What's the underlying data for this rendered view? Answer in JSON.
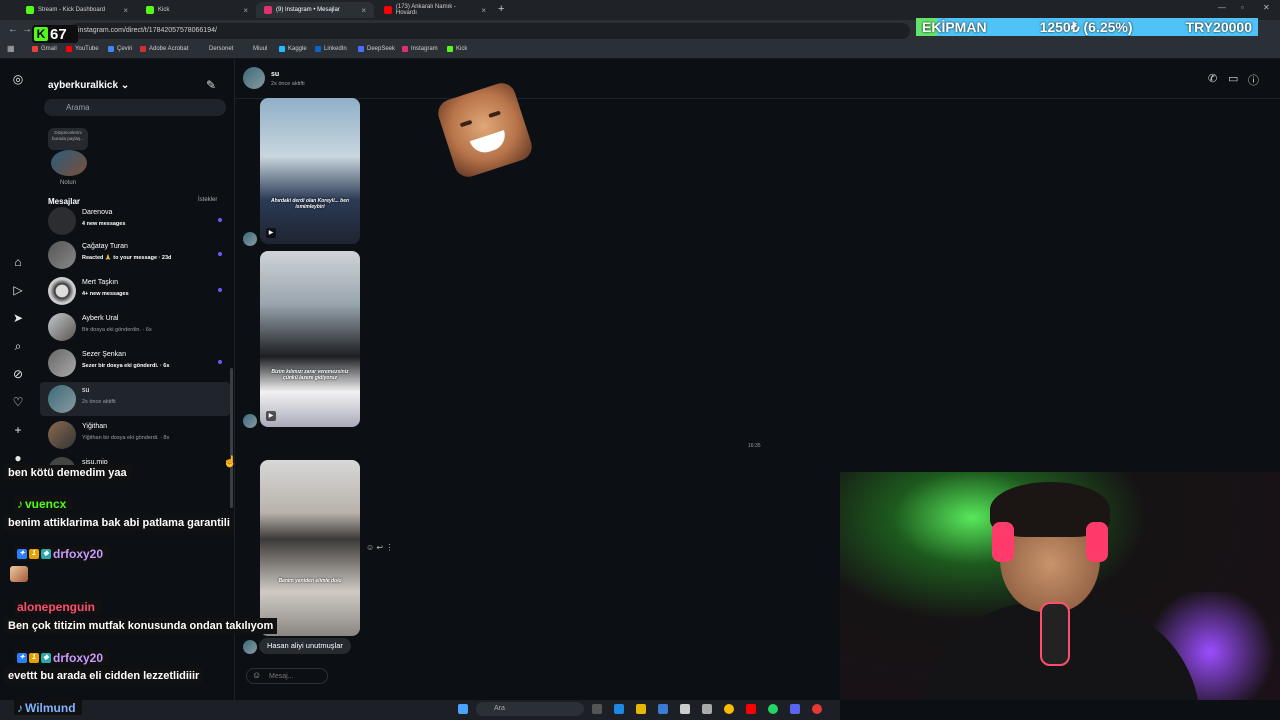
{
  "browser": {
    "tabs": [
      {
        "label": "Stream - Kick Dashboard",
        "color": "#53fc18",
        "active": false
      },
      {
        "label": "Kick",
        "color": "#53fc18",
        "active": false
      },
      {
        "label": "(9) Instagram • Mesajlar",
        "color": "#e1306c",
        "active": true
      },
      {
        "label": "(173) Ankaralı Namık - Hovardı",
        "color": "#ff0000",
        "active": false
      }
    ],
    "url": "instagram.com/direct/t/17842057578066194/",
    "bookmarks": [
      "Gmail",
      "YouTube",
      "Çeviri",
      "Adobe Acrobat",
      "Dersonet",
      "Miuul",
      "Kaggle",
      "LinkedIn",
      "DeepSeek",
      "Instagram",
      "Kick"
    ]
  },
  "overlay": {
    "kick_viewers": "67",
    "ekipman_label": "EKİPMAN",
    "ekipman_progress": "1250₺ (6.25%)",
    "ekipman_goal": "TRY20000",
    "ekipman_fraction": 0.0625
  },
  "instagram": {
    "username": "ayberkuralkick",
    "search_placeholder": "Arama",
    "note_text": "Düşüncelerini burada paylaş...",
    "note_label": "Notun",
    "messages_header": "Mesajlar",
    "requests_label": "İstekler",
    "conversations": [
      {
        "name": "Darenova",
        "sub": "4 new messages",
        "unread": true
      },
      {
        "name": "Çağatay Turan",
        "sub": "Reacted 🙏 to your message · 23d",
        "unread": true
      },
      {
        "name": "Mert Taşkın",
        "sub": "4+ new messages",
        "unread": true
      },
      {
        "name": "Ayberk Ural",
        "sub": "Bir dosya eki gönderdin. · 6s",
        "unread": false
      },
      {
        "name": "Sezer Şenkan",
        "sub": "Sezer bir dosya eki gönderdi. · 6s",
        "unread": true
      },
      {
        "name": "su",
        "sub": "2s önce aktifti",
        "unread": false
      },
      {
        "name": "Yiğithan",
        "sub": "Yiğithan bir dosya eki gönderdi. · 8s",
        "unread": false
      },
      {
        "name": "sisu.mio",
        "sub": "",
        "unread": false
      }
    ],
    "chat": {
      "name": "su",
      "status": "2s önce aktifti",
      "reel1_caption": "Ahırdaki derdi olan Koreyli... ben ismimleybiri",
      "reel2_caption": "Bizim kılımızı zarar veremezsiniz çünkü lazere gidiyoruz",
      "reel3_caption": "Benim yeniden elimle dolu",
      "timestamp": "16:35",
      "last_message": "Hasan aliyi unutmuşlar",
      "input_placeholder": "Mesaj..."
    }
  },
  "stream_chat": [
    {
      "user": "vuencx",
      "color": "#53fc18"
    },
    {
      "text": "benim attiklarima bak abi patlama garantili"
    },
    {
      "user": "drfoxy20",
      "color": "#c89bff"
    },
    {
      "user": "alonepenguin",
      "color": "#ff4d6d"
    },
    {
      "text": "Ben çok titizim mutfak konusunda ondan takılıyom"
    },
    {
      "user": "drfoxy20",
      "color": "#c89bff"
    },
    {
      "text": "evettt bu arada eli cidden lezzetlidiiir"
    },
    {
      "user": "Wilmund",
      "color": "#7fb3ff"
    },
    {
      "text": "ben kötü demedim yaa"
    }
  ],
  "taskbar": {
    "search_placeholder": "Ara"
  }
}
